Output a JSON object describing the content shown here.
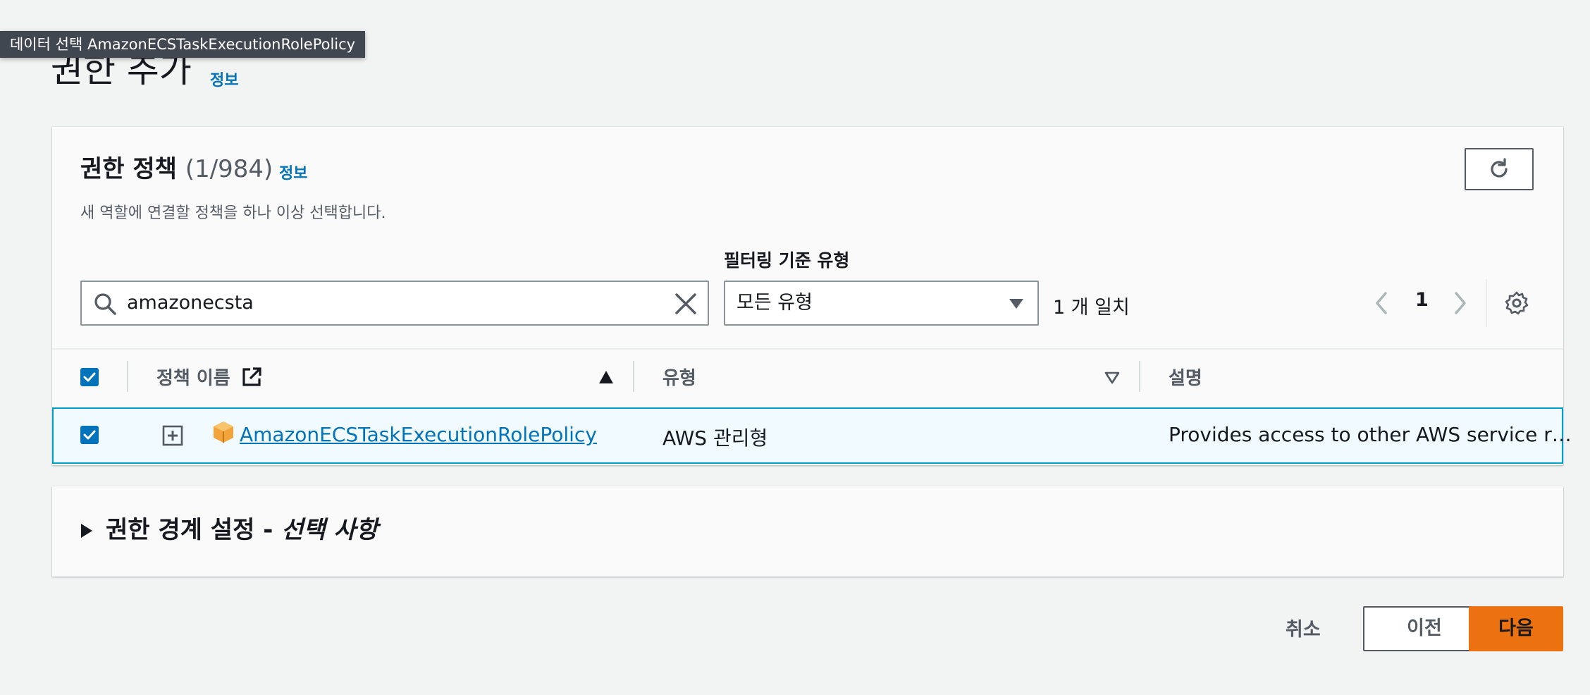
{
  "tooltip": "데이터 선택 AmazonECSTaskExecutionRolePolicy",
  "page": {
    "title": "권한 추가",
    "info_label": "정보"
  },
  "policies_panel": {
    "title": "권한 정책",
    "count": "(1/984)",
    "info_label": "정보",
    "description": "새 역할에 연결할 정책을 하나 이상 선택합니다.",
    "refresh_icon": "refresh-icon"
  },
  "filters": {
    "search_value": "amazonecsta",
    "type_label": "필터링 기준 유형",
    "type_selected": "모든 유형",
    "match_text": "1 개 일치"
  },
  "pagination": {
    "current_page": "1"
  },
  "table": {
    "columns": [
      "정책 이름",
      "유형",
      "설명"
    ],
    "rows": [
      {
        "selected": true,
        "name": "AmazonECSTaskExecutionRolePolicy",
        "type": "AWS 관리형",
        "description": "Provides access to other AWS service r…"
      }
    ]
  },
  "boundary_section": {
    "title": "권한 경계 설정 - ",
    "optional": "선택 사항"
  },
  "actions": {
    "cancel": "취소",
    "previous": "이전",
    "next": "다음"
  },
  "colors": {
    "accent": "#0073bb",
    "primary_button": "#ec7211",
    "selected_row_bg": "#f1faff",
    "selected_row_border": "#00a1c9"
  }
}
